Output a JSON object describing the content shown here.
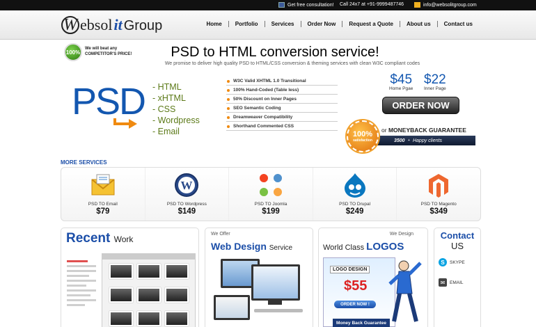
{
  "topbar": {
    "consult": "Get free consultation!",
    "phone": "Call 24x7 at +91-9999487746",
    "email": "info@websolitgroup.com"
  },
  "logo": {
    "w": "W",
    "ebsol": "ebsol",
    "it": "it",
    "group": "Group"
  },
  "nav": [
    "Home",
    "Portfolio",
    "Services",
    "Order Now",
    "Request a Quote",
    "About us",
    "Contact us"
  ],
  "hero": {
    "badge": "100%",
    "beat": "We will beat any COMPETITOR'S PRICE!",
    "title": "PSD to HTML conversion service!",
    "subtitle": "We promise to deliver high quality PSD to HTML/CSS conversion & theming services with clean W3C compliant codes",
    "psd": "PSD",
    "formats": [
      "HTML",
      "xHTML",
      "CSS",
      "Wordpress",
      "Email"
    ],
    "features": [
      "W3C Valid XHTML 1.0 Transitional",
      "100% Hand-Coded (Table less)",
      "50% Discount on Inner Pages",
      "SEO Semantic Coding",
      "Dreamweaver Compatibility",
      "Shorthand Commented CSS"
    ],
    "prices": [
      {
        "amount": "$45",
        "label": "Home Pgae"
      },
      {
        "amount": "$22",
        "label": "Inner Page"
      }
    ],
    "order_button": "ORDER NOW",
    "satisfaction": {
      "num": "100%",
      "text": "satisfaction"
    },
    "guarantee": {
      "or": "or",
      "text": "MONEYBACK GUARANTEE"
    },
    "clients": {
      "count": "3500",
      "plus": "+",
      "label": "Happy clients"
    }
  },
  "more_services": {
    "title": "MORE SERVICES",
    "items": [
      {
        "name": "PSD TO Email",
        "price": "$79",
        "icon": "email-envelope-icon"
      },
      {
        "name": "PSD TO Wordpress",
        "price": "$149",
        "icon": "wordpress-icon"
      },
      {
        "name": "PSD TO Joomla",
        "price": "$199",
        "icon": "joomla-icon"
      },
      {
        "name": "PSD TO Drupal",
        "price": "$249",
        "icon": "drupal-icon"
      },
      {
        "name": "PSD TO Magento",
        "price": "$349",
        "icon": "magento-icon"
      }
    ]
  },
  "recent": {
    "title": "Recent",
    "work": "Work"
  },
  "webdesign": {
    "we_offer": "We Offer",
    "title": "Web Design",
    "service": "Service"
  },
  "logos": {
    "we_design": "We Design",
    "world_class": "World Class",
    "logos": "LOGOS",
    "card_title": "LOGO DESIGN",
    "price": "$55",
    "order": "ORDER NOW !",
    "mbg": "Money Back Guarantee"
  },
  "contact": {
    "title": "Contact",
    "us": "US",
    "skype": "SKYPE",
    "email": "EMAIL"
  },
  "colors": {
    "brand_blue": "#1b4ea8",
    "psd_blue": "#1357b0",
    "accent_orange": "#f08a10",
    "format_green": "#5c7a18"
  }
}
